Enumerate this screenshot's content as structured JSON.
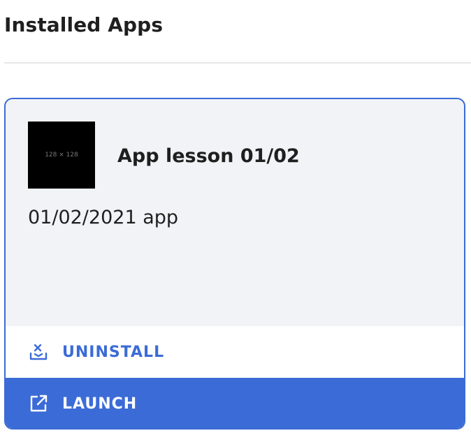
{
  "page": {
    "title": "Installed Apps"
  },
  "app": {
    "thumbnail_label": "128 × 128",
    "name": "App lesson 01/02",
    "description": "01/02/2021 app"
  },
  "actions": {
    "uninstall_label": "UNINSTALL",
    "launch_label": "LAUNCH"
  },
  "colors": {
    "accent": "#3b6bd6",
    "card_bg": "#f2f3f7"
  }
}
